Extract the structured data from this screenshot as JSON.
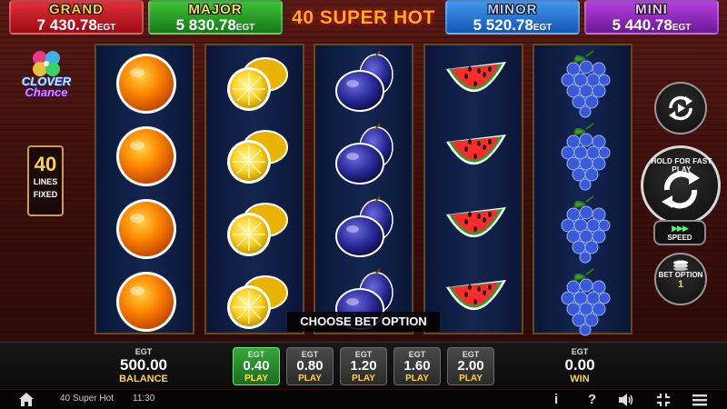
{
  "jackpots": {
    "grand": {
      "title": "GRAND",
      "value": "7 430.78",
      "currency": "EGT",
      "color": "#c8141e"
    },
    "major": {
      "title": "MAJOR",
      "value": "5 830.78",
      "currency": "EGT",
      "color": "#2a9a2a"
    },
    "minor": {
      "title": "MINOR",
      "value": "5 520.78",
      "currency": "EGT",
      "color": "#1e6ed0"
    },
    "mini": {
      "title": "MINI",
      "value": "5 440.78",
      "currency": "EGT",
      "color": "#8a2ab8"
    }
  },
  "game_title": "40 SUPER HOT",
  "clover_logo": {
    "line1": "CLOVER",
    "line2": "Chance"
  },
  "lines": {
    "count": "40",
    "label1": "LINES",
    "label2": "FIXED"
  },
  "reels": [
    {
      "symbol": "orange",
      "count": 4
    },
    {
      "symbol": "lemon",
      "count": 4
    },
    {
      "symbol": "plum",
      "count": 4
    },
    {
      "symbol": "watermelon",
      "count": 4
    },
    {
      "symbol": "grapes",
      "count": 4
    }
  ],
  "bet_tooltip": "CHOOSE BET OPTION",
  "controls": {
    "spin_hint": "HOLD FOR FAST PLAY",
    "speed_label": "SPEED",
    "bet_option_label": "BET OPTION",
    "bet_option_value": "1"
  },
  "balance": {
    "currency": "EGT",
    "value": "500.00",
    "label": "BALANCE"
  },
  "win": {
    "currency": "EGT",
    "value": "0.00",
    "label": "WIN"
  },
  "bets": [
    {
      "currency": "EGT",
      "value": "0.40",
      "label": "PLAY",
      "active": true
    },
    {
      "currency": "EGT",
      "value": "0.80",
      "label": "PLAY",
      "active": false
    },
    {
      "currency": "EGT",
      "value": "1.20",
      "label": "PLAY",
      "active": false
    },
    {
      "currency": "EGT",
      "value": "1.60",
      "label": "PLAY",
      "active": false
    },
    {
      "currency": "EGT",
      "value": "2.00",
      "label": "PLAY",
      "active": false
    }
  ],
  "status_bar": {
    "game_name": "40 Super Hot",
    "time": "11:30",
    "info_glyph": "i",
    "help_glyph": "?",
    "icons": [
      "home-icon",
      "info-icon",
      "help-icon",
      "sound-icon",
      "fullscreen-icon",
      "menu-icon"
    ]
  }
}
